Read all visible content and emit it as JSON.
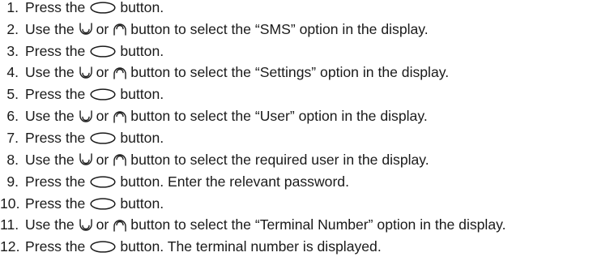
{
  "steps": [
    {
      "number": "1.",
      "parts": [
        {
          "t": "text",
          "v": "Press the"
        },
        {
          "t": "icon",
          "v": "oval-button-icon"
        },
        {
          "t": "text",
          "v": "button."
        }
      ]
    },
    {
      "number": "2.",
      "parts": [
        {
          "t": "text",
          "v": "Use the"
        },
        {
          "t": "icon",
          "v": "down-button-icon"
        },
        {
          "t": "text",
          "v": "or"
        },
        {
          "t": "icon",
          "v": "up-button-icon"
        },
        {
          "t": "text",
          "v": "button to select the “SMS” option in the display."
        }
      ]
    },
    {
      "number": "3.",
      "parts": [
        {
          "t": "text",
          "v": "Press the"
        },
        {
          "t": "icon",
          "v": "oval-button-icon"
        },
        {
          "t": "text",
          "v": "button."
        }
      ]
    },
    {
      "number": "4.",
      "parts": [
        {
          "t": "text",
          "v": "Use the"
        },
        {
          "t": "icon",
          "v": "down-button-icon"
        },
        {
          "t": "text",
          "v": "or"
        },
        {
          "t": "icon",
          "v": "up-button-icon"
        },
        {
          "t": "text",
          "v": "button to select the “Settings” option in the display."
        }
      ]
    },
    {
      "number": "5.",
      "parts": [
        {
          "t": "text",
          "v": "Press the"
        },
        {
          "t": "icon",
          "v": "oval-button-icon"
        },
        {
          "t": "text",
          "v": "button."
        }
      ]
    },
    {
      "number": "6.",
      "parts": [
        {
          "t": "text",
          "v": "Use the"
        },
        {
          "t": "icon",
          "v": "down-button-icon"
        },
        {
          "t": "text",
          "v": "or"
        },
        {
          "t": "icon",
          "v": "up-button-icon"
        },
        {
          "t": "text",
          "v": "button to select the “User” option in the display."
        }
      ]
    },
    {
      "number": "7.",
      "parts": [
        {
          "t": "text",
          "v": "Press the"
        },
        {
          "t": "icon",
          "v": "oval-button-icon"
        },
        {
          "t": "text",
          "v": "button."
        }
      ]
    },
    {
      "number": "8.",
      "parts": [
        {
          "t": "text",
          "v": "Use the"
        },
        {
          "t": "icon",
          "v": "down-button-icon"
        },
        {
          "t": "text",
          "v": "or"
        },
        {
          "t": "icon",
          "v": "up-button-icon"
        },
        {
          "t": "text",
          "v": "button to select the required user in the display."
        }
      ]
    },
    {
      "number": "9.",
      "parts": [
        {
          "t": "text",
          "v": "Press the"
        },
        {
          "t": "icon",
          "v": "oval-button-icon"
        },
        {
          "t": "text",
          "v": "button. Enter the relevant password."
        }
      ]
    },
    {
      "number": "10.",
      "parts": [
        {
          "t": "text",
          "v": "Press the"
        },
        {
          "t": "icon",
          "v": "oval-button-icon"
        },
        {
          "t": "text",
          "v": "button."
        }
      ]
    },
    {
      "number": "11.",
      "parts": [
        {
          "t": "text",
          "v": "Use the"
        },
        {
          "t": "icon",
          "v": "down-button-icon"
        },
        {
          "t": "text",
          "v": "or"
        },
        {
          "t": "icon",
          "v": "up-button-icon"
        },
        {
          "t": "text",
          "v": "button to select the “Terminal Number” option in the display."
        }
      ]
    },
    {
      "number": "12.",
      "parts": [
        {
          "t": "text",
          "v": "Press the"
        },
        {
          "t": "icon",
          "v": "oval-button-icon"
        },
        {
          "t": "text",
          "v": "button. The terminal number is displayed."
        }
      ]
    }
  ],
  "colors": {
    "text": "#1a1a1a",
    "background": "#ffffff"
  }
}
